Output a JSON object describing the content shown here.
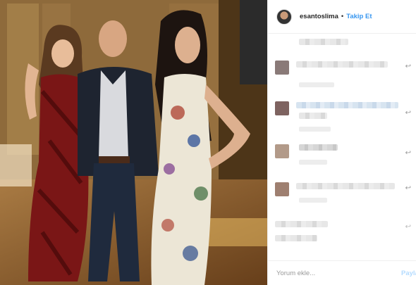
{
  "post": {
    "username": "esantoslima",
    "separator": "•",
    "follow_label": "Takip Et",
    "photo_icon": "photo-image"
  },
  "comments": {
    "reply_glyph": "↩"
  },
  "footer": {
    "comment_placeholder": "Yorum ekle...",
    "share_label": "Paylaş"
  },
  "colors": {
    "link_blue": "#3897f0",
    "share_disabled": "#b3dbff",
    "text_dark": "#262626",
    "border": "#efefef"
  }
}
